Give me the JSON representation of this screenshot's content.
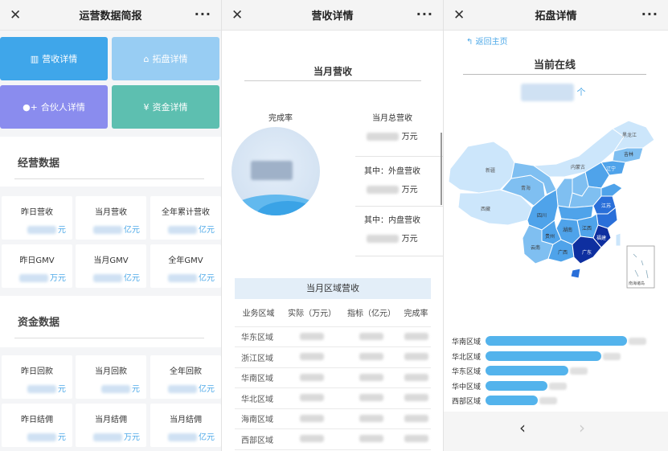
{
  "panel1": {
    "title": "运营数据简报",
    "tiles": [
      {
        "label": "营收详情",
        "icon": "bar-chart-icon",
        "glyph": "▥",
        "color": "#3fa6ea"
      },
      {
        "label": "拓盘详情",
        "icon": "bank-icon",
        "glyph": "🏛",
        "color": "#98cdf3"
      },
      {
        "label": "合伙人详情",
        "icon": "users-icon",
        "glyph": "👥",
        "color": "#8a8cee"
      },
      {
        "label": "资金详情",
        "icon": "yen-icon",
        "glyph": "¥",
        "color": "#5dbfb0"
      }
    ],
    "business": {
      "title": "经营数据",
      "cards": [
        {
          "label": "昨日营收",
          "unit": "元"
        },
        {
          "label": "当月营收",
          "unit": "亿元"
        },
        {
          "label": "全年累计营收",
          "unit": "亿元"
        },
        {
          "label": "昨日GMV",
          "unit": "万元"
        },
        {
          "label": "当月GMV",
          "unit": "亿元"
        },
        {
          "label": "全年GMV",
          "unit": "亿元"
        }
      ]
    },
    "funds": {
      "title": "资金数据",
      "cards": [
        {
          "label": "昨日回款",
          "unit": "元"
        },
        {
          "label": "当月回款",
          "unit": "元"
        },
        {
          "label": "全年回款",
          "unit": "亿元"
        },
        {
          "label": "昨日结佣",
          "unit": "元"
        },
        {
          "label": "当月结佣",
          "unit": "万元"
        },
        {
          "label": "当月结佣",
          "unit": "亿元"
        }
      ]
    }
  },
  "panel2": {
    "title": "营收详情",
    "month_title": "当月营收",
    "completion_label": "完成率",
    "revenue_items": [
      {
        "label": "当月总营收",
        "unit": "万元"
      },
      {
        "label": "其中：外盘营收",
        "unit": "万元"
      },
      {
        "label": "其中：内盘营收",
        "unit": "万元"
      }
    ],
    "region_table": {
      "title": "当月区域营收",
      "headers": [
        "业务区域",
        "实际（万元）",
        "指标（亿元）",
        "完成率"
      ],
      "rows": [
        "华东区域",
        "浙江区域",
        "华南区域",
        "华北区域",
        "海南区域",
        "西部区域"
      ]
    }
  },
  "panel3": {
    "title": "拓盘详情",
    "back_label": "返回主页",
    "online_title": "当前在线",
    "online_unit": "个",
    "legend_colors": [
      "#b7dcf7",
      "#4a90e2",
      "#1a4fc9",
      "#0b2a8a",
      "#081b5e"
    ],
    "map_colors": {
      "light": "#cce6fb",
      "mid": "#7fbff1",
      "mid2": "#4fa3ea",
      "dark": "#2a6fd9",
      "darkest": "#0e2fa0"
    },
    "map_labels": [
      "新疆",
      "西藏",
      "青海",
      "四川",
      "内蒙古",
      "黑龙江",
      "吉林",
      "辽宁",
      "江苏",
      "江西",
      "福建",
      "广东",
      "广西",
      "贵州",
      "云南",
      "湖南",
      "南海诸岛"
    ],
    "bars": [
      {
        "label": "华南区域",
        "value": 0.98
      },
      {
        "label": "华北区域",
        "value": 0.8
      },
      {
        "label": "华东区域",
        "value": 0.57
      },
      {
        "label": "华中区域",
        "value": 0.43
      },
      {
        "label": "西部区域",
        "value": 0.36
      }
    ]
  }
}
